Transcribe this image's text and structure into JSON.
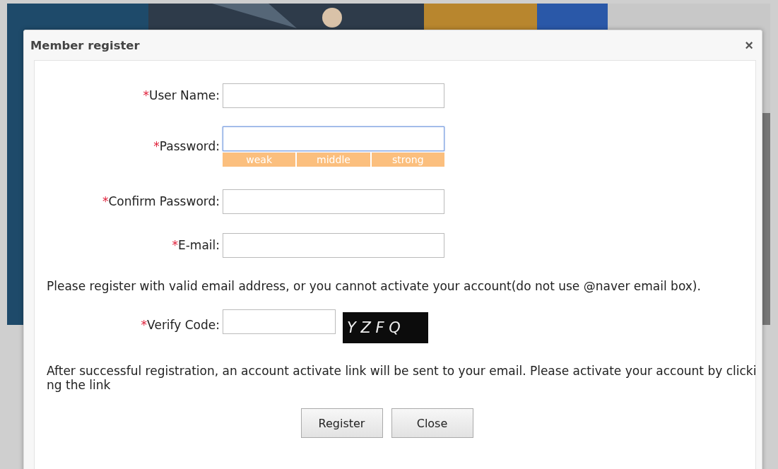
{
  "dialog": {
    "title": "Member register",
    "close": "×"
  },
  "fields": [
    {
      "kind": "text",
      "mark": "*",
      "label": "User Name:",
      "focused": false
    },
    {
      "kind": "password",
      "mark": "*",
      "label": "Password:",
      "focused": true,
      "strength": [
        "weak",
        "middle",
        "strong"
      ]
    },
    {
      "kind": "text",
      "mark": "*",
      "label": "Confirm Password:",
      "focused": false
    },
    {
      "kind": "text",
      "mark": "*",
      "label": "E-mail:",
      "focused": false
    }
  ],
  "email_note": "Please register with valid email address, or you cannot activate your account(do not use @naver email box).",
  "verify": {
    "mark": "*",
    "label": "Verify Code:",
    "captcha": "Y Z F Q"
  },
  "activation_note": [
    "After successful registration, an account activate link will be sent to your email. Please activate your account by clicki",
    "ng the link"
  ],
  "buttons": [
    "Register",
    "Close"
  ]
}
